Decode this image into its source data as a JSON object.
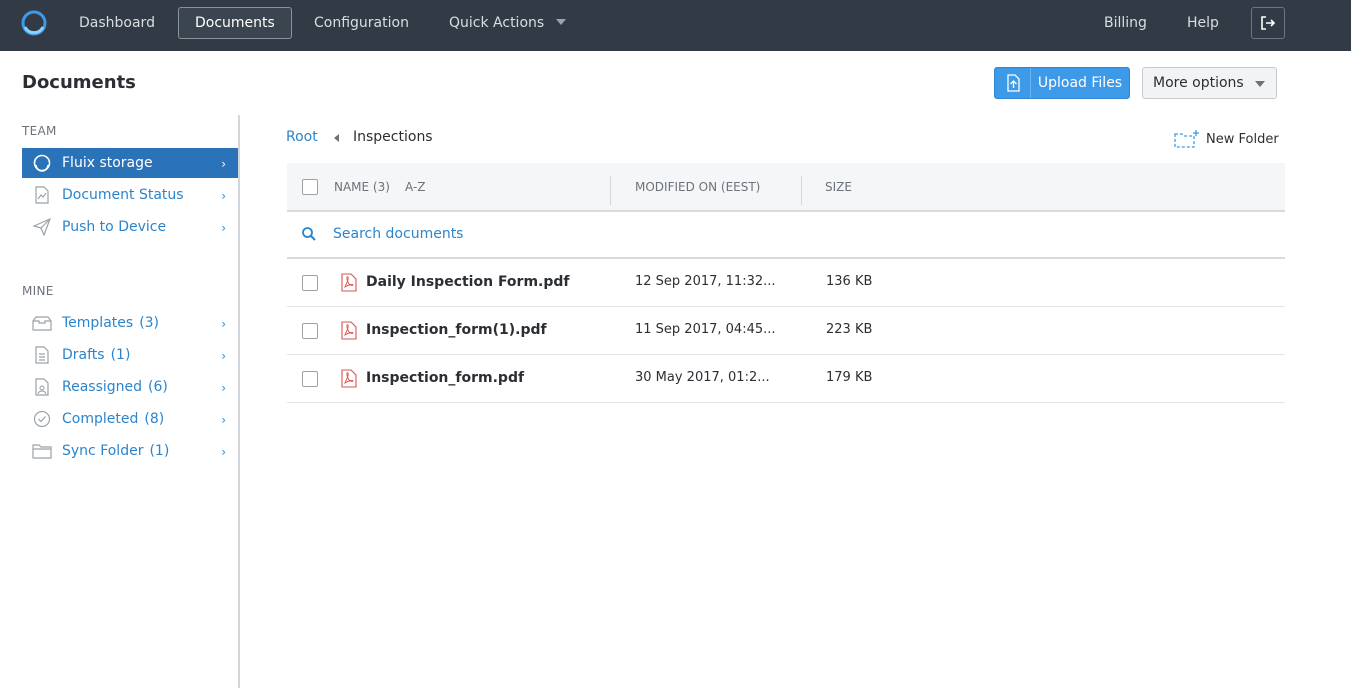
{
  "topbar": {
    "nav": [
      "Dashboard",
      "Documents",
      "Configuration",
      "Quick Actions"
    ],
    "active": "Documents",
    "right": [
      "Billing",
      "Help"
    ]
  },
  "page": {
    "title": "Documents",
    "upload_label": "Upload Files",
    "more_label": "More options"
  },
  "sidebar": {
    "team_label": "TEAM",
    "team_items": [
      {
        "label": "Fluix storage",
        "icon": "fluix-storage-icon"
      },
      {
        "label": "Document Status",
        "icon": "document-status-icon"
      },
      {
        "label": "Push to Device",
        "icon": "paper-plane-icon"
      }
    ],
    "mine_label": "MINE",
    "mine_items": [
      {
        "label": "Templates",
        "count": "(3)",
        "icon": "inbox-tray-icon"
      },
      {
        "label": "Drafts",
        "count": "(1)",
        "icon": "document-icon"
      },
      {
        "label": "Reassigned",
        "count": "(6)",
        "icon": "reassign-document-icon"
      },
      {
        "label": "Completed",
        "count": "(8)",
        "icon": "check-circle-icon"
      },
      {
        "label": "Sync Folder",
        "count": "(1)",
        "icon": "folder-icon"
      }
    ]
  },
  "breadcrumb": {
    "root": "Root",
    "current": "Inspections"
  },
  "new_folder_label": "New Folder",
  "table": {
    "col_name": "NAME (3)",
    "sort_label": "A-Z",
    "col_modified": "MODIFIED ON (EEST)",
    "col_size": "SIZE",
    "search_placeholder": "Search documents",
    "rows": [
      {
        "name": "Daily Inspection Form.pdf",
        "modified": "12 Sep 2017, 11:32...",
        "size": "136 KB"
      },
      {
        "name": "Inspection_form(1).pdf",
        "modified": "11 Sep 2017, 04:45...",
        "size": "223 KB"
      },
      {
        "name": "Inspection_form.pdf",
        "modified": "30 May 2017, 01:2...",
        "size": "179 KB"
      }
    ]
  },
  "colors": {
    "topbar": "#323b45",
    "accent": "#2c84cc",
    "upload": "#3d9ae8",
    "active_side": "#2b73b8",
    "pdf_red": "#d9534f"
  }
}
